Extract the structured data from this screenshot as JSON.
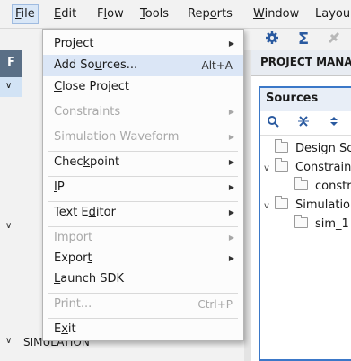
{
  "menubar": {
    "items": [
      {
        "pre": "",
        "acc": "F",
        "post": "ile"
      },
      {
        "pre": "",
        "acc": "E",
        "post": "dit"
      },
      {
        "pre": "F",
        "acc": "l",
        "post": "ow"
      },
      {
        "pre": "",
        "acc": "T",
        "post": "ools"
      },
      {
        "pre": "Rep",
        "acc": "o",
        "post": "rts"
      },
      {
        "pre": "",
        "acc": "W",
        "post": "indow"
      },
      {
        "pre": "Layou",
        "acc": "",
        "post": ""
      }
    ]
  },
  "toolbar": {
    "icons": [
      "gear-icon",
      "sigma-icon",
      "disabled-tool-icon"
    ],
    "sigma_glyph": "Σ"
  },
  "left_panel": {
    "header_label": "F",
    "simulation_label": "SIMULATION"
  },
  "right_panel": {
    "header": "PROJECT MANA",
    "sources_title": "Sources",
    "tree": [
      {
        "label": "Design Sc",
        "chevron": ""
      },
      {
        "label": "Constrain",
        "chevron": "v"
      },
      {
        "label": "constr",
        "chevron": ""
      },
      {
        "label": "Simulation",
        "chevron": "v"
      },
      {
        "label": "sim_1",
        "chevron": ""
      }
    ]
  },
  "file_menu": {
    "items": [
      {
        "pre": "",
        "acc": "P",
        "post": "roject",
        "shortcut": "",
        "submenu": true,
        "disabled": false
      },
      {
        "pre": "Add So",
        "acc": "u",
        "post": "rces...",
        "shortcut": "Alt+A",
        "submenu": false,
        "disabled": false,
        "highlighted": true
      },
      {
        "pre": "",
        "acc": "C",
        "post": "lose Project",
        "shortcut": "",
        "submenu": false,
        "disabled": false
      },
      {
        "pre": "Constraints",
        "acc": "",
        "post": "",
        "shortcut": "",
        "submenu": true,
        "disabled": true
      },
      {
        "pre": "Simulation Waveform",
        "acc": "",
        "post": "",
        "shortcut": "",
        "submenu": true,
        "disabled": true
      },
      {
        "pre": "Chec",
        "acc": "k",
        "post": "point",
        "shortcut": "",
        "submenu": true,
        "disabled": false
      },
      {
        "pre": "",
        "acc": "I",
        "post": "P",
        "shortcut": "",
        "submenu": true,
        "disabled": false
      },
      {
        "pre": "Text E",
        "acc": "d",
        "post": "itor",
        "shortcut": "",
        "submenu": true,
        "disabled": false
      },
      {
        "pre": "Import",
        "acc": "",
        "post": "",
        "shortcut": "",
        "submenu": true,
        "disabled": true
      },
      {
        "pre": "Expor",
        "acc": "t",
        "post": "",
        "shortcut": "",
        "submenu": true,
        "disabled": false
      },
      {
        "pre": "",
        "acc": "L",
        "post": "aunch SDK",
        "shortcut": "",
        "submenu": false,
        "disabled": false
      },
      {
        "pre": "Print...",
        "acc": "",
        "post": "",
        "shortcut": "Ctrl+P",
        "submenu": false,
        "disabled": true
      },
      {
        "pre": "E",
        "acc": "x",
        "post": "it",
        "shortcut": "",
        "submenu": false,
        "disabled": false
      }
    ],
    "arrow_glyph": "▶"
  },
  "colors": {
    "highlight": "#dbe6f6",
    "accent_blue": "#3b78c8",
    "disabled_text": "#a8a8a8"
  }
}
